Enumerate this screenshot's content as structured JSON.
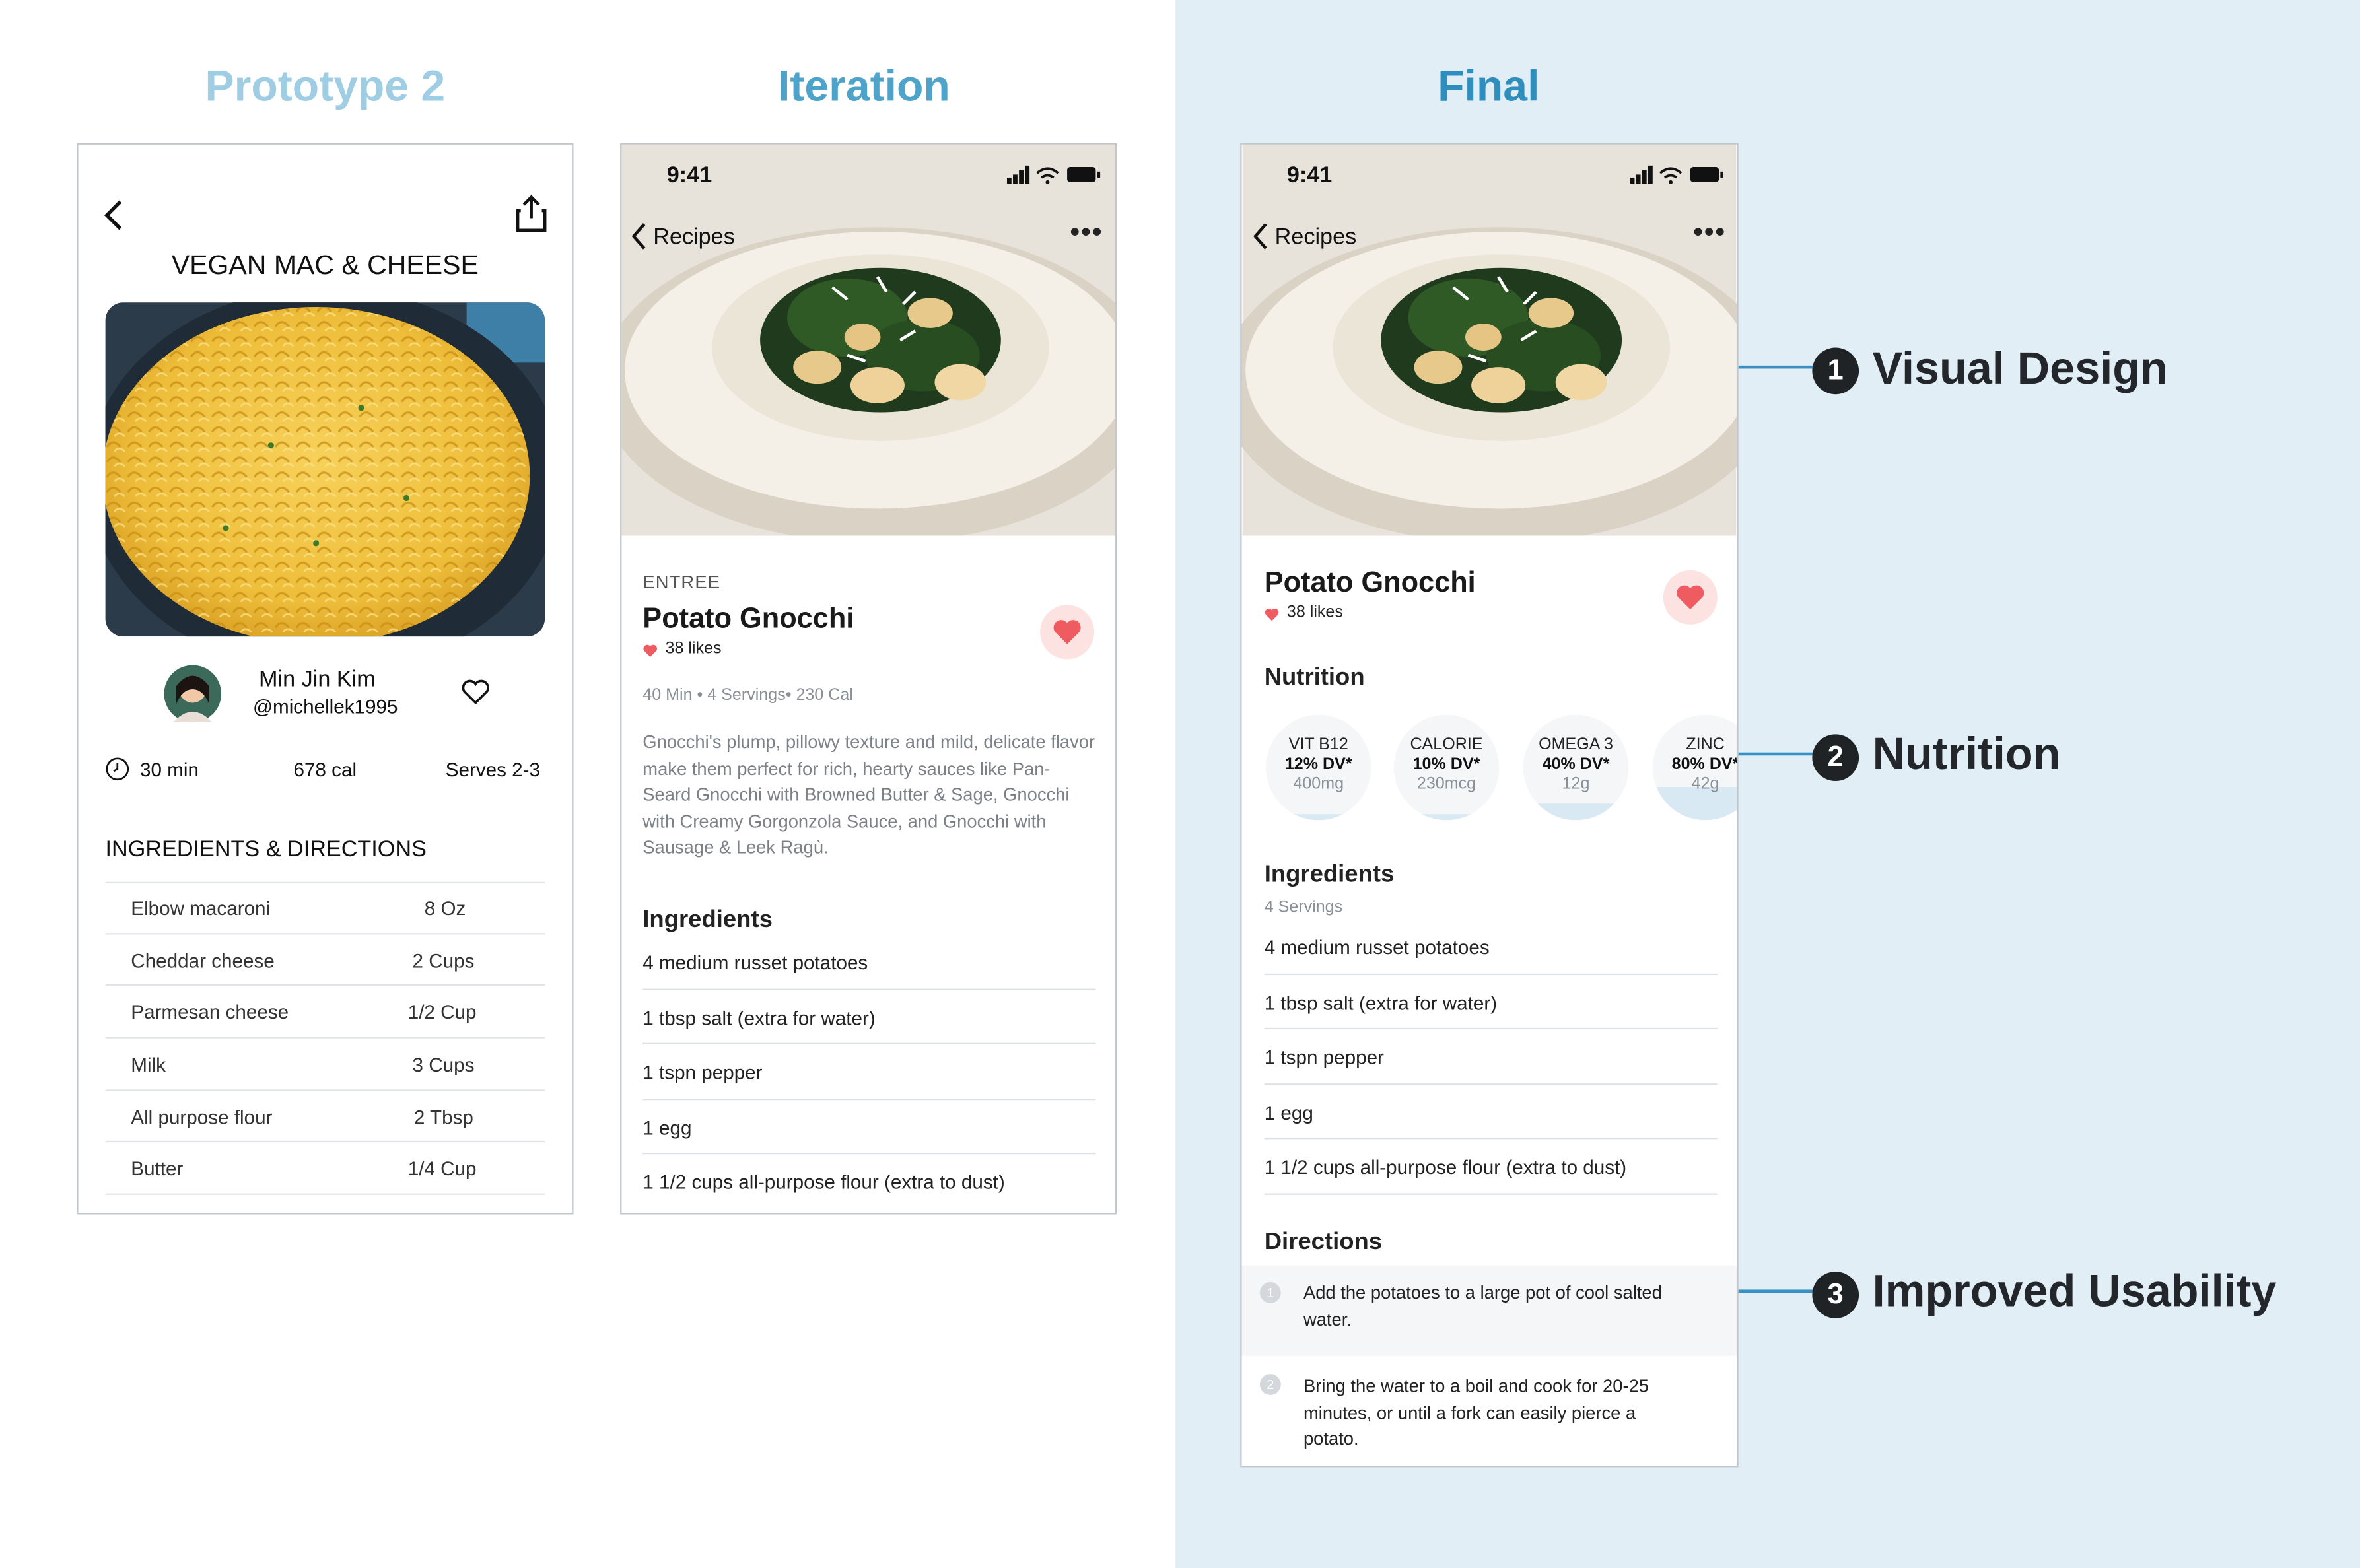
{
  "columns": {
    "prototype": "Prototype 2",
    "iteration": "Iteration",
    "final": "Final"
  },
  "colors": {
    "prototype_title": "#9ecde4",
    "iteration_title": "#4da3c9",
    "final_title": "#2e8fbe",
    "panel_bg": "#e1eef6",
    "heart": "#ee5b61",
    "annotation_line": "#3a8fc1"
  },
  "prototype": {
    "title": "VEGAN MAC & CHEESE",
    "author_name": "Min Jin Kim",
    "author_handle": "@michellek1995",
    "time": "30 min",
    "calories": "678 cal",
    "serves": "Serves 2-3",
    "section_title": "INGREDIENTS & DIRECTIONS",
    "ingredients": [
      {
        "name": "Elbow macaroni",
        "qty": "8 Oz"
      },
      {
        "name": "Cheddar cheese",
        "qty": "2 Cups"
      },
      {
        "name": "Parmesan cheese",
        "qty": "1/2 Cup"
      },
      {
        "name": "Milk",
        "qty": "3 Cups"
      },
      {
        "name": "All purpose flour",
        "qty": "2 Tbsp"
      },
      {
        "name": "Butter",
        "qty": "1/4 Cup"
      }
    ]
  },
  "iteration": {
    "time": "9:41",
    "back_label": "Recipes",
    "more_label": "•••",
    "category": "ENTREE",
    "title": "Potato Gnocchi",
    "likes": "38 likes",
    "meta": "40 Min • 4 Servings• 230 Cal",
    "description": "Gnocchi's plump, pillowy texture and mild, delicate flavor make them perfect for rich, hearty sauces like Pan-Seard Gnocchi with Browned Butter & Sage, Gnocchi with Creamy Gorgonzola Sauce, and Gnocchi with Sausage & Leek Ragù.",
    "ingredients_title": "Ingredients",
    "ingredients": [
      "4 medium russet potatoes",
      "1 tbsp salt (extra for water)",
      "1 tspn pepper",
      "1 egg",
      "1 1/2 cups all-purpose flour (extra to dust)"
    ]
  },
  "final": {
    "time": "9:41",
    "back_label": "Recipes",
    "more_label": "•••",
    "title": "Potato Gnocchi",
    "likes": "38 likes",
    "nutrition_title": "Nutrition",
    "nutrition": [
      {
        "name": "VIT B12",
        "pct": "12% DV*",
        "amount": "400mg",
        "level": 0.12
      },
      {
        "name": "CALORIE",
        "pct": "10% DV*",
        "amount": "230mcg",
        "level": 0.1
      },
      {
        "name": "OMEGA 3",
        "pct": "40% DV*",
        "amount": "12g",
        "level": 0.4
      },
      {
        "name": "ZINC",
        "pct": "80% DV*",
        "amount": "42g",
        "level": 0.8
      }
    ],
    "ingredients_title": "Ingredients",
    "servings": "4 Servings",
    "ingredients": [
      "4 medium russet potatoes",
      "1 tbsp salt (extra for water)",
      "1 tspn pepper",
      "1 egg",
      "1 1/2 cups all-purpose flour (extra to dust)"
    ],
    "directions_title": "Directions",
    "directions": [
      {
        "num": "1",
        "text": "Add the potatoes to a large pot of cool salted water."
      },
      {
        "num": "2",
        "text": "Bring the water to a boil and cook for 20-25 minutes, or until a fork can easily pierce a potato."
      }
    ]
  },
  "annotations": [
    {
      "num": "1",
      "label": "Visual Design"
    },
    {
      "num": "2",
      "label": "Nutrition"
    },
    {
      "num": "3",
      "label": "Improved Usability"
    }
  ]
}
